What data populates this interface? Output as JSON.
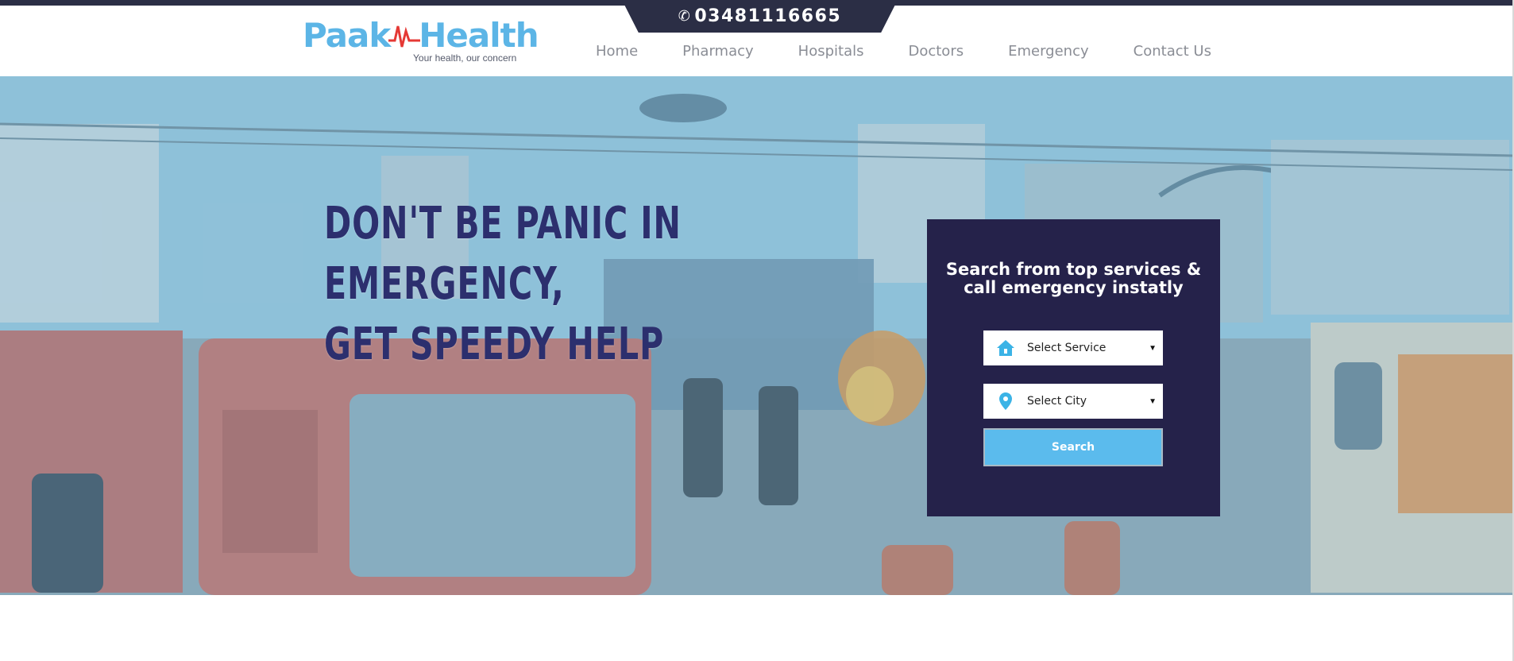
{
  "topbar": {
    "phone": "03481116665",
    "phone_icon": "phone-icon"
  },
  "logo": {
    "name_part1": "Paak",
    "name_part2": "Health",
    "tagline": "Your health, our concern",
    "brand_color": "#5cb5e6",
    "pulse_color": "#e53935"
  },
  "nav": {
    "items": [
      "Home",
      "Pharmacy",
      "Hospitals",
      "Doctors",
      "Emergency",
      "Contact Us"
    ]
  },
  "hero": {
    "line1": "DON'T BE PANIC IN EMERGENCY,",
    "line2": "GET SPEEDY HELP",
    "background_scene": "fire-rescue-scene-image"
  },
  "search": {
    "title": "Search from top services & call emergency instatly",
    "service_select": "Select Service",
    "service_icon": "home-icon",
    "city_select": "Select City",
    "city_icon": "location-pin-icon",
    "button": "Search",
    "box_color": "#25224a",
    "button_color": "#5bbbed"
  }
}
